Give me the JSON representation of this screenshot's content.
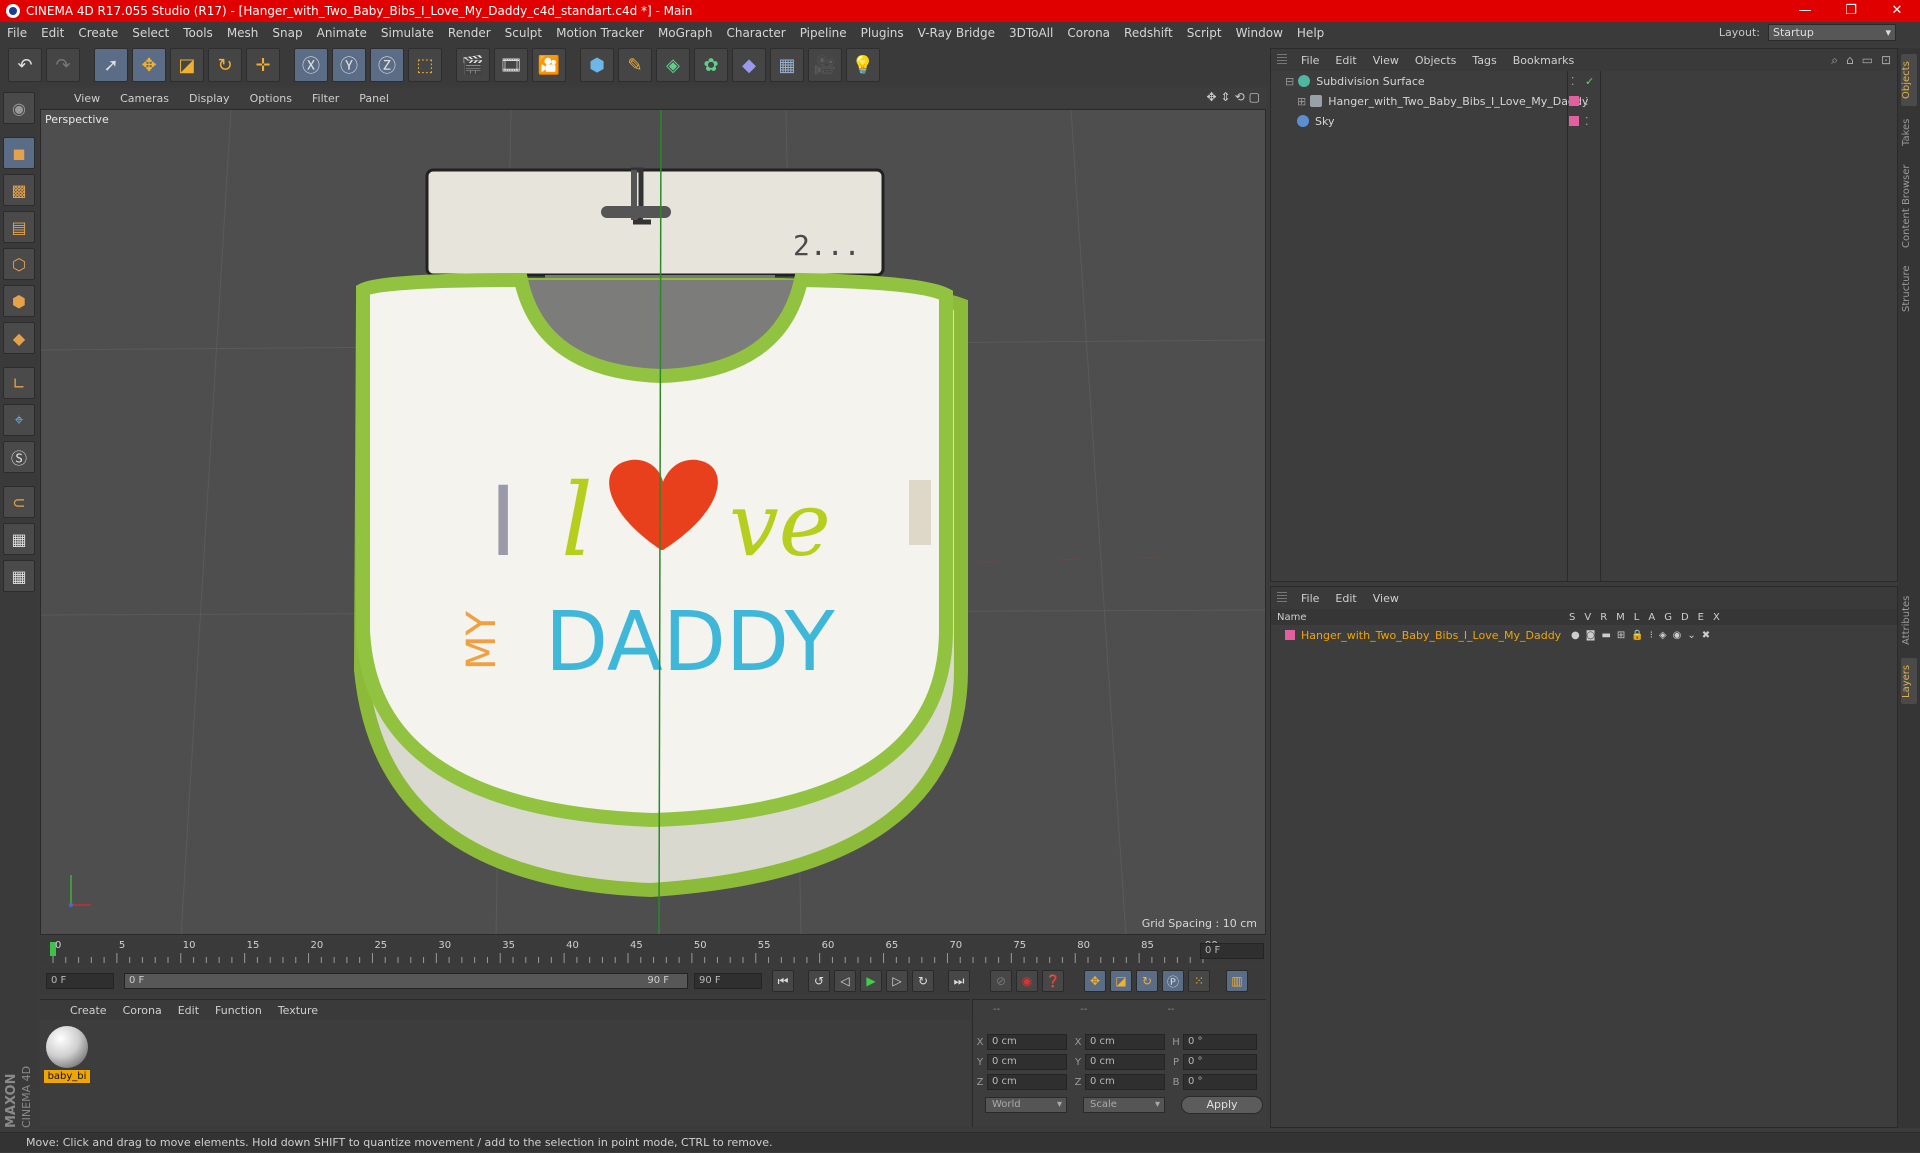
{
  "window": {
    "title": "CINEMA 4D R17.055 Studio (R17) - [Hanger_with_Two_Baby_Bibs_I_Love_My_Daddy_c4d_standart.c4d *] - Main"
  },
  "menu": [
    "File",
    "Edit",
    "Create",
    "Select",
    "Tools",
    "Mesh",
    "Snap",
    "Animate",
    "Simulate",
    "Render",
    "Sculpt",
    "Motion Tracker",
    "MoGraph",
    "Character",
    "Pipeline",
    "Plugins",
    "V-Ray Bridge",
    "3DToAll",
    "Corona",
    "Redshift",
    "Script",
    "Window",
    "Help"
  ],
  "layout": {
    "label": "Layout:",
    "value": "Startup"
  },
  "viewport": {
    "menu": [
      "View",
      "Cameras",
      "Display",
      "Options",
      "Filter",
      "Panel"
    ],
    "label": "Perspective",
    "grid_spacing": "Grid Spacing : 10 cm",
    "bib_text_i": "I",
    "bib_text_love_start": "l",
    "bib_text_love_end": "ve",
    "bib_text_my": "MY",
    "bib_text_daddy": "DADDY",
    "bib_tag": "2..."
  },
  "timeline": {
    "ticks": [
      "0",
      "5",
      "10",
      "15",
      "20",
      "25",
      "30",
      "35",
      "40",
      "45",
      "50",
      "55",
      "60",
      "65",
      "70",
      "75",
      "80",
      "85",
      "90"
    ],
    "current_frame": "0 F",
    "start": "0 F",
    "range_start": "0 F",
    "range_end": "90 F",
    "end": "90 F"
  },
  "material_panel": {
    "menu": [
      "Create",
      "Corona",
      "Edit",
      "Function",
      "Texture"
    ],
    "material_name": "baby_bi"
  },
  "coords": {
    "headers": [
      "--",
      "--",
      "--"
    ],
    "rows": [
      {
        "a": "X",
        "av": "0 cm",
        "b": "X",
        "bv": "0 cm",
        "c": "H",
        "cv": "0 °"
      },
      {
        "a": "Y",
        "av": "0 cm",
        "b": "Y",
        "bv": "0 cm",
        "c": "P",
        "cv": "0 °"
      },
      {
        "a": "Z",
        "av": "0 cm",
        "b": "Z",
        "bv": "0 cm",
        "c": "B",
        "cv": "0 °"
      }
    ],
    "mode1": "World",
    "mode2": "Scale",
    "apply": "Apply"
  },
  "objects_panel": {
    "menu": [
      "File",
      "Edit",
      "View",
      "Objects",
      "Tags",
      "Bookmarks"
    ],
    "items": [
      {
        "name": "Subdivision Surface",
        "color": "#4fb7a0"
      },
      {
        "name": "Hanger_with_Two_Baby_Bibs_I_Love_My_Daddy",
        "color": "#9aa0a8"
      },
      {
        "name": "Sky",
        "color": "#5b8fd1"
      }
    ]
  },
  "layers_panel": {
    "menu": [
      "File",
      "Edit",
      "View"
    ],
    "name_header": "Name",
    "col_headers": [
      "S",
      "V",
      "R",
      "M",
      "L",
      "A",
      "G",
      "D",
      "E",
      "X"
    ],
    "layer_name": "Hanger_with_Two_Baby_Bibs_I_Love_My_Daddy",
    "layer_color": "#f0a500"
  },
  "right_tabs": [
    "Objects",
    "Takes",
    "Content Browser",
    "Structure",
    "Attributes",
    "Layers"
  ],
  "status": "Move: Click and drag to move elements. Hold down SHIFT to quantize movement / add to the selection in point mode, CTRL to remove.",
  "brand": {
    "line1": "MAXON",
    "line2": "CINEMA 4D"
  }
}
